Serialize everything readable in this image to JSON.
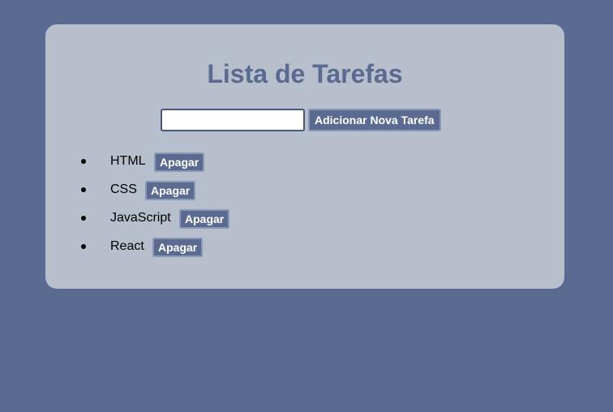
{
  "app": {
    "title": "Lista de Tarefas"
  },
  "form": {
    "input_value": "",
    "input_placeholder": "",
    "add_label": "Adicionar Nova Tarefa"
  },
  "tasks": [
    {
      "label": "HTML",
      "delete_label": "Apagar"
    },
    {
      "label": "CSS",
      "delete_label": "Apagar"
    },
    {
      "label": "JavaScript",
      "delete_label": "Apagar"
    },
    {
      "label": "React",
      "delete_label": "Apagar"
    }
  ],
  "colors": {
    "background": "#5a6a91",
    "card": "#b7bfcc",
    "accent": "#5a6a91",
    "button_text": "#ffffff"
  }
}
